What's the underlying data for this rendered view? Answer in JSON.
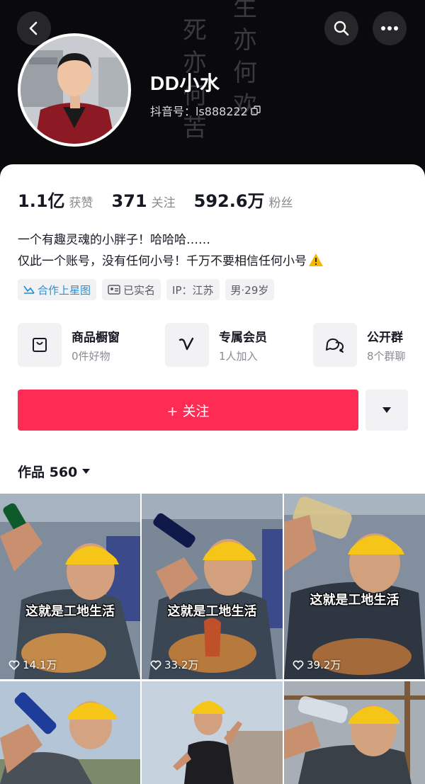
{
  "profile": {
    "nickname": "DD小水",
    "douyin_id": "抖音号：ls888222",
    "background_text": [
      "死",
      "亦",
      "何",
      "苦",
      "生",
      "亦",
      "何",
      "欢"
    ]
  },
  "stats": {
    "likes_value": "1.1亿",
    "likes_label": "获赞",
    "following_value": "371",
    "following_label": "关注",
    "followers_value": "592.6万",
    "followers_label": "粉丝"
  },
  "bio": {
    "line1": "一个有趣灵魂的小胖子！哈哈哈……",
    "line2": "仅此一个账号，没有任何小号！千万不要相信任何小号"
  },
  "tags": {
    "star_map": "合作上星图",
    "verified": "已实名",
    "ip": "IP：江苏",
    "gender_age": "男·29岁"
  },
  "services": [
    {
      "title": "商品橱窗",
      "subtitle": "0件好物",
      "icon": "bag-icon"
    },
    {
      "title": "专属会员",
      "subtitle": "1人加入",
      "icon": "v-badge-icon"
    },
    {
      "title": "公开群",
      "subtitle": "8个群聊",
      "icon": "chat-bubbles-icon"
    }
  ],
  "actions": {
    "follow_label": "+ 关注"
  },
  "works": {
    "label": "作品 560",
    "items": [
      {
        "caption": "这就是工地生活",
        "likes": "14.1万"
      },
      {
        "caption": "这就是工地生活",
        "likes": "33.2万"
      },
      {
        "caption": "这就是工地生活",
        "likes": "39.2万"
      },
      {
        "caption": "",
        "likes": ""
      },
      {
        "caption": "",
        "likes": ""
      },
      {
        "caption": "",
        "likes": ""
      }
    ]
  },
  "colors": {
    "accent": "#fe2c55",
    "header_bg": "#0a0a0c",
    "star_blue": "#2a8fd6",
    "warning": "#f5b800"
  }
}
